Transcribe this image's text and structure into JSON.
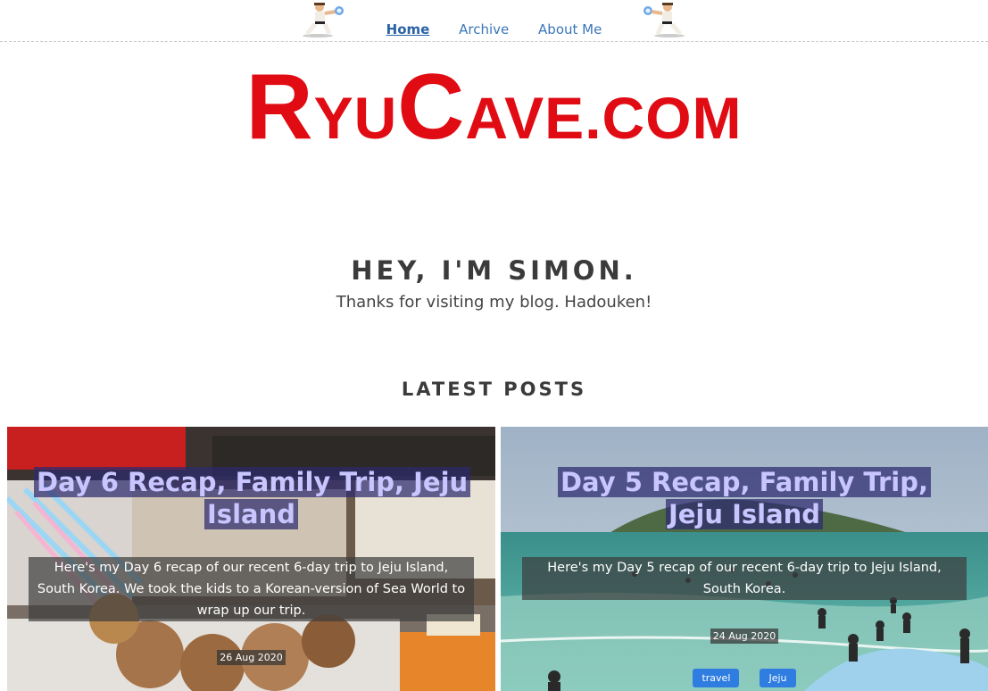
{
  "nav": {
    "links": [
      {
        "label": "Home",
        "active": true
      },
      {
        "label": "Archive",
        "active": false
      },
      {
        "label": "About Me",
        "active": false
      }
    ]
  },
  "logo": {
    "first_big": "R",
    "first_small": "YU",
    "second_big": "C",
    "second_small": "AVE.COM",
    "color": "#e00b13"
  },
  "intro": {
    "heading": "HEY, I'M SIMON.",
    "tagline": "Thanks for visiting my blog. Hadouken!"
  },
  "latest": {
    "heading": "LATEST POSTS"
  },
  "posts": [
    {
      "title": "Day 6 Recap, Family Trip, Jeju Island",
      "excerpt": "Here's my Day 6 recap of our recent 6-day trip to Jeju Island, South Korea. We took the kids to a Korean-version of Sea World to wrap up our trip.",
      "date": "26 Aug 2020",
      "tags": [
        "",
        "",
        ""
      ]
    },
    {
      "title": "Day 5 Recap, Family Trip, Jeju Island",
      "excerpt": "Here's my Day 5 recap of our recent 6-day trip to Jeju Island, South Korea.",
      "date": "24 Aug 2020",
      "tags": [
        "travel",
        "Jeju"
      ]
    }
  ],
  "colors": {
    "link": "#3a77b8",
    "tag": "#2f7de0",
    "title_text": "#c9c6ff"
  }
}
